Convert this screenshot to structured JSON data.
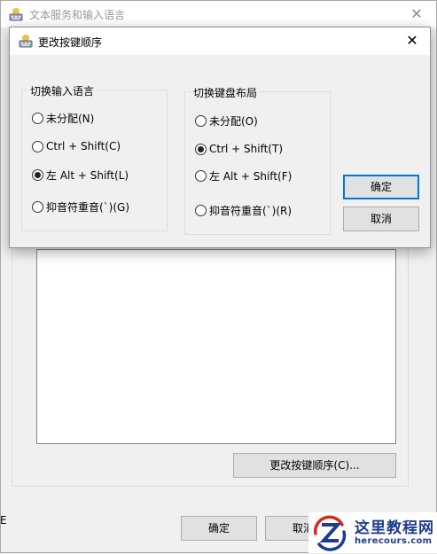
{
  "parent_window": {
    "title": "文本服务和输入语言",
    "change_sequence_label": "更改按键顺序(C)...",
    "ok_label": "确定",
    "cancel_label": "取消",
    "edge_char": "E"
  },
  "dialog": {
    "title": "更改按键顺序",
    "ok_label": "确定",
    "cancel_label": "取消",
    "switch_input_language": {
      "legend": "切换输入语言",
      "options": [
        {
          "label": "未分配(N)",
          "checked": false
        },
        {
          "label": "Ctrl + Shift(C)",
          "checked": false
        },
        {
          "label": "左 Alt + Shift(L)",
          "checked": true
        },
        {
          "label": "抑音符重音(`)(G)",
          "checked": false
        }
      ]
    },
    "switch_keyboard_layout": {
      "legend": "切换键盘布局",
      "options": [
        {
          "label": "未分配(O)",
          "checked": false
        },
        {
          "label": "Ctrl + Shift(T)",
          "checked": true
        },
        {
          "label": "左 Alt + Shift(F)",
          "checked": false
        },
        {
          "label": "抑音符重音(`)(R)",
          "checked": false
        }
      ]
    }
  },
  "watermark": {
    "site_name_cn": "这里教程网",
    "site_url": "herecours.com"
  },
  "colors": {
    "accent": "#0078d7",
    "watermark_blue": "#1f3d8e",
    "watermark_red": "#d9261c"
  }
}
